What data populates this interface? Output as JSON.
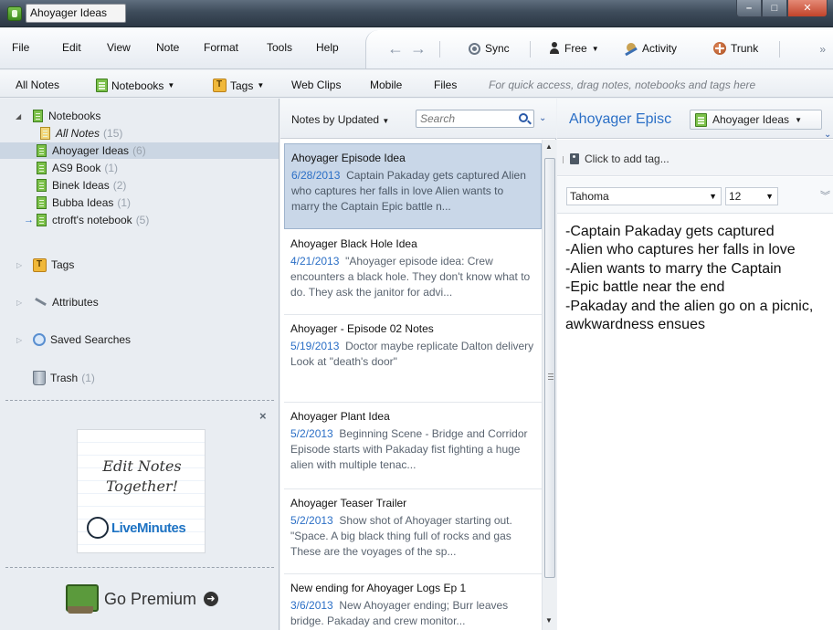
{
  "window": {
    "title": "Ahoyager Ideas",
    "buttons": {
      "minimize": "–",
      "maximize": "□",
      "close": "✕"
    }
  },
  "menu": {
    "items": [
      "File",
      "Edit",
      "View",
      "Note",
      "Format",
      "Tools",
      "Help"
    ]
  },
  "toolbar": {
    "back": "←",
    "forward": "→",
    "sync": "Sync",
    "free": "Free",
    "activity": "Activity",
    "trunk": "Trunk"
  },
  "shortcuts": {
    "all_notes": "All Notes",
    "notebooks": "Notebooks",
    "tags": "Tags",
    "web_clips": "Web Clips",
    "mobile": "Mobile",
    "files": "Files",
    "hint": "For quick access, drag notes, notebooks and tags here"
  },
  "sidebar": {
    "notebooks_label": "Notebooks",
    "all_notes": {
      "label": "All Notes",
      "count": "(15)"
    },
    "notebooks": [
      {
        "label": "Ahoyager Ideas",
        "count": "(6)"
      },
      {
        "label": "AS9 Book",
        "count": "(1)"
      },
      {
        "label": "Binek Ideas",
        "count": "(2)"
      },
      {
        "label": "Bubba Ideas",
        "count": "(1)"
      },
      {
        "label": "ctroft's notebook",
        "count": "(5)"
      }
    ],
    "tags": "Tags",
    "attributes": "Attributes",
    "saved_searches": "Saved Searches",
    "trash": {
      "label": "Trash",
      "count": "(1)"
    }
  },
  "ad": {
    "close": "×",
    "line1": "Edit Notes",
    "line2": "Together!",
    "brand": "LiveMinutes"
  },
  "premium": {
    "label": "Go Premium",
    "arrow": "➜"
  },
  "note_list": {
    "sort_label": "Notes by Updated",
    "search_placeholder": "Search",
    "notes": [
      {
        "title": "Ahoyager Episode Idea",
        "date": "6/28/2013",
        "snippet": "Captain Pakaday gets captured Alien who captures her falls in love Alien wants to marry the Captain Epic battle n..."
      },
      {
        "title": "Ahoyager Black Hole Idea",
        "date": "4/21/2013",
        "snippet": "\"Ahoyager episode idea: Crew encounters a black hole. They don't know what to do. They ask the janitor for advi..."
      },
      {
        "title": "Ahoyager - Episode 02 Notes",
        "date": "5/19/2013",
        "snippet": "Doctor maybe replicate Dalton delivery Look at \"death's door\""
      },
      {
        "title": "Ahoyager Plant Idea",
        "date": "5/2/2013",
        "snippet": "Beginning Scene - Bridge and Corridor Episode starts with Pakaday fist fighting a huge alien with multiple tenac..."
      },
      {
        "title": "Ahoyager Teaser Trailer",
        "date": "5/2/2013",
        "snippet": "Show shot of Ahoyager starting out. \"Space. A big black thing full of rocks and gas These are the voyages of the sp..."
      },
      {
        "title": "New ending for Ahoyager Logs Ep 1",
        "date": "3/6/2013",
        "snippet": "New Ahoyager ending; Burr leaves bridge. Pakaday and crew monitor..."
      }
    ]
  },
  "editor": {
    "title": "Ahoyager Episc",
    "notebook": "Ahoyager Ideas",
    "tag_placeholder": "Click to add tag...",
    "font": "Tahoma",
    "size": "12",
    "body": "-Captain Pakaday gets captured\n-Alien who captures her falls in love\n-Alien wants to marry the Captain\n-Epic battle near the end\n-Pakaday and the alien go on a picnic, awkwardness ensues"
  }
}
